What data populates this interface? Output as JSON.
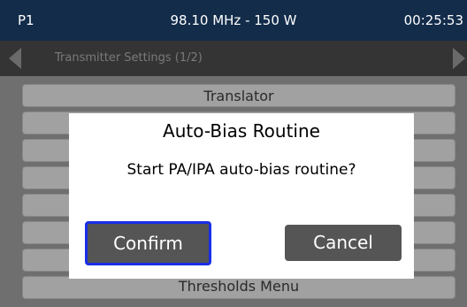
{
  "status_bar": {
    "profile": "P1",
    "frequency_power": "98.10 MHz - 150 W",
    "time": "00:25:53"
  },
  "nav_bar": {
    "title": "Transmitter Settings (1/2)",
    "left_icon": "arrow-left-icon",
    "right_icon": "arrow-right-icon"
  },
  "menu": {
    "items": [
      {
        "label": "Translator"
      },
      {
        "label": ""
      },
      {
        "label": ""
      },
      {
        "label": ""
      },
      {
        "label": ""
      },
      {
        "label": ""
      },
      {
        "label": ""
      },
      {
        "label": "Thresholds Menu"
      }
    ]
  },
  "dialog": {
    "title": "Auto-Bias Routine",
    "message": "Start PA/IPA auto-bias routine?",
    "confirm_label": "Confirm",
    "cancel_label": "Cancel"
  },
  "colors": {
    "status_bar_bg": "#132c4a",
    "nav_bar_bg": "#343434",
    "screen_bg": "#6f6f6f",
    "menu_item_bg": "#a1a1a1",
    "button_bg": "#555555",
    "focus_border": "#1a2ee8"
  }
}
